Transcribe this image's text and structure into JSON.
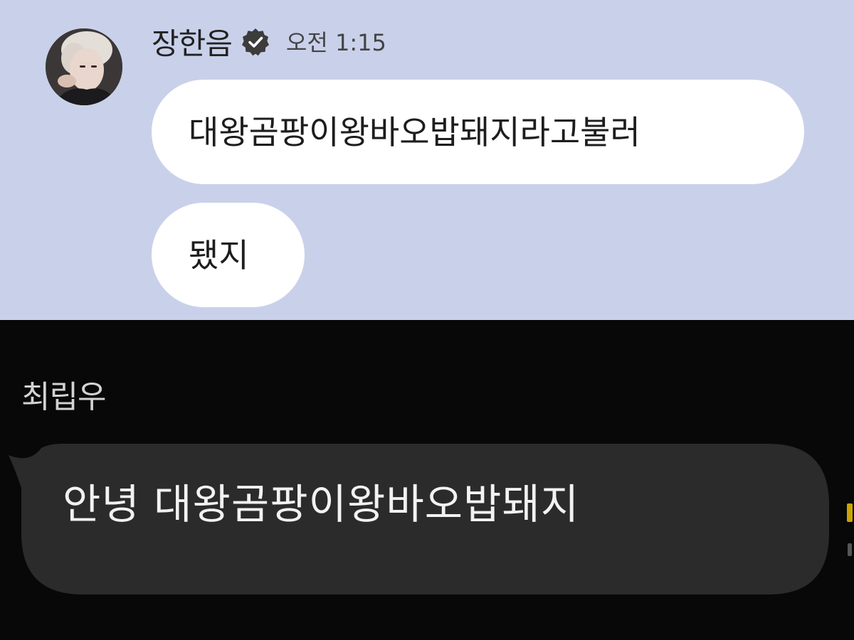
{
  "top_chat": {
    "sender_name": "장한음",
    "timestamp": "오전 1:15",
    "avatar_icon": "profile-photo",
    "verified_icon": "verified-badge-icon",
    "messages": [
      {
        "text": "대왕곰팡이왕바오밥돼지라고불러"
      },
      {
        "text": "됐지"
      }
    ],
    "colors": {
      "background": "#c9d1ea",
      "bubble": "#ffffff"
    }
  },
  "bottom_chat": {
    "sender_name": "최립우",
    "message": {
      "text": "안녕 대왕곰팡이왕바오밥돼지"
    },
    "colors": {
      "background": "#080808",
      "bubble": "#2b2b2b"
    }
  }
}
